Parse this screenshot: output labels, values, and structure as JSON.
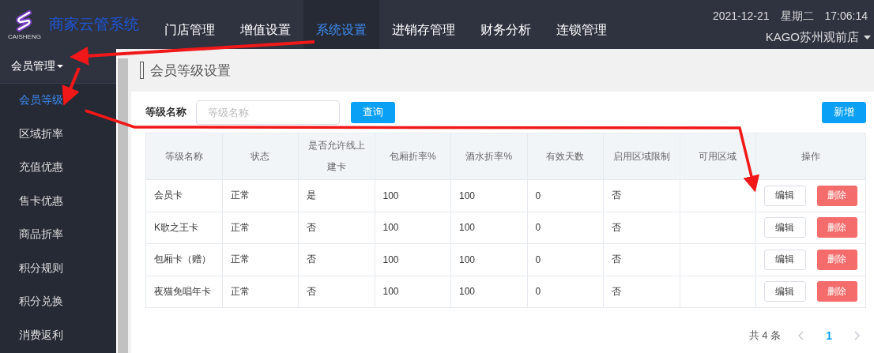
{
  "header": {
    "logo_text": "CAISHENG",
    "app_title": "商家云管系统",
    "nav": [
      {
        "label": "门店管理",
        "selected": false
      },
      {
        "label": "增值设置",
        "selected": false
      },
      {
        "label": "系统设置",
        "selected": true
      },
      {
        "label": "进销存管理",
        "selected": false
      },
      {
        "label": "财务分析",
        "selected": false
      },
      {
        "label": "连锁管理",
        "selected": false
      }
    ],
    "date": "2021-12-21",
    "weekday": "星期二",
    "time": "17:06:14",
    "store": "KAGO苏州观前店"
  },
  "sidebar": {
    "group": "会员管理",
    "items": [
      {
        "label": "会员等级",
        "selected": true
      },
      {
        "label": "区域折率",
        "selected": false
      },
      {
        "label": "充值优惠",
        "selected": false
      },
      {
        "label": "售卡优惠",
        "selected": false
      },
      {
        "label": "商品折率",
        "selected": false
      },
      {
        "label": "积分规则",
        "selected": false
      },
      {
        "label": "积分兑换",
        "selected": false
      },
      {
        "label": "消费返利",
        "selected": false
      }
    ]
  },
  "page_title": "会员等级设置",
  "search": {
    "label": "等级名称",
    "placeholder": "等级名称",
    "button": "查询"
  },
  "add_button": "新增",
  "table": {
    "columns": [
      "等级名称",
      "状态",
      "是否允许线上建卡",
      "包厢折率%",
      "酒水折率%",
      "有效天数",
      "启用区域限制",
      "可用区域",
      "操作"
    ],
    "rows": [
      {
        "cells": [
          "会员卡",
          "正常",
          "是",
          "100",
          "100",
          "0",
          "否",
          ""
        ],
        "actions": [
          "编辑",
          "删除"
        ]
      },
      {
        "cells": [
          "K歌之王卡",
          "正常",
          "否",
          "100",
          "100",
          "0",
          "否",
          ""
        ],
        "actions": [
          "编辑",
          "删除"
        ]
      },
      {
        "cells": [
          "包厢卡（赠）",
          "正常",
          "否",
          "100",
          "100",
          "0",
          "否",
          ""
        ],
        "actions": [
          "编辑",
          "删除"
        ]
      },
      {
        "cells": [
          "夜猫免唱年卡",
          "正常",
          "否",
          "100",
          "100",
          "0",
          "否",
          ""
        ],
        "actions": [
          "编辑",
          "删除"
        ]
      }
    ]
  },
  "pagination": {
    "total": "共 4 条",
    "pages": [
      {
        "label": "1",
        "selected": true
      }
    ]
  }
}
